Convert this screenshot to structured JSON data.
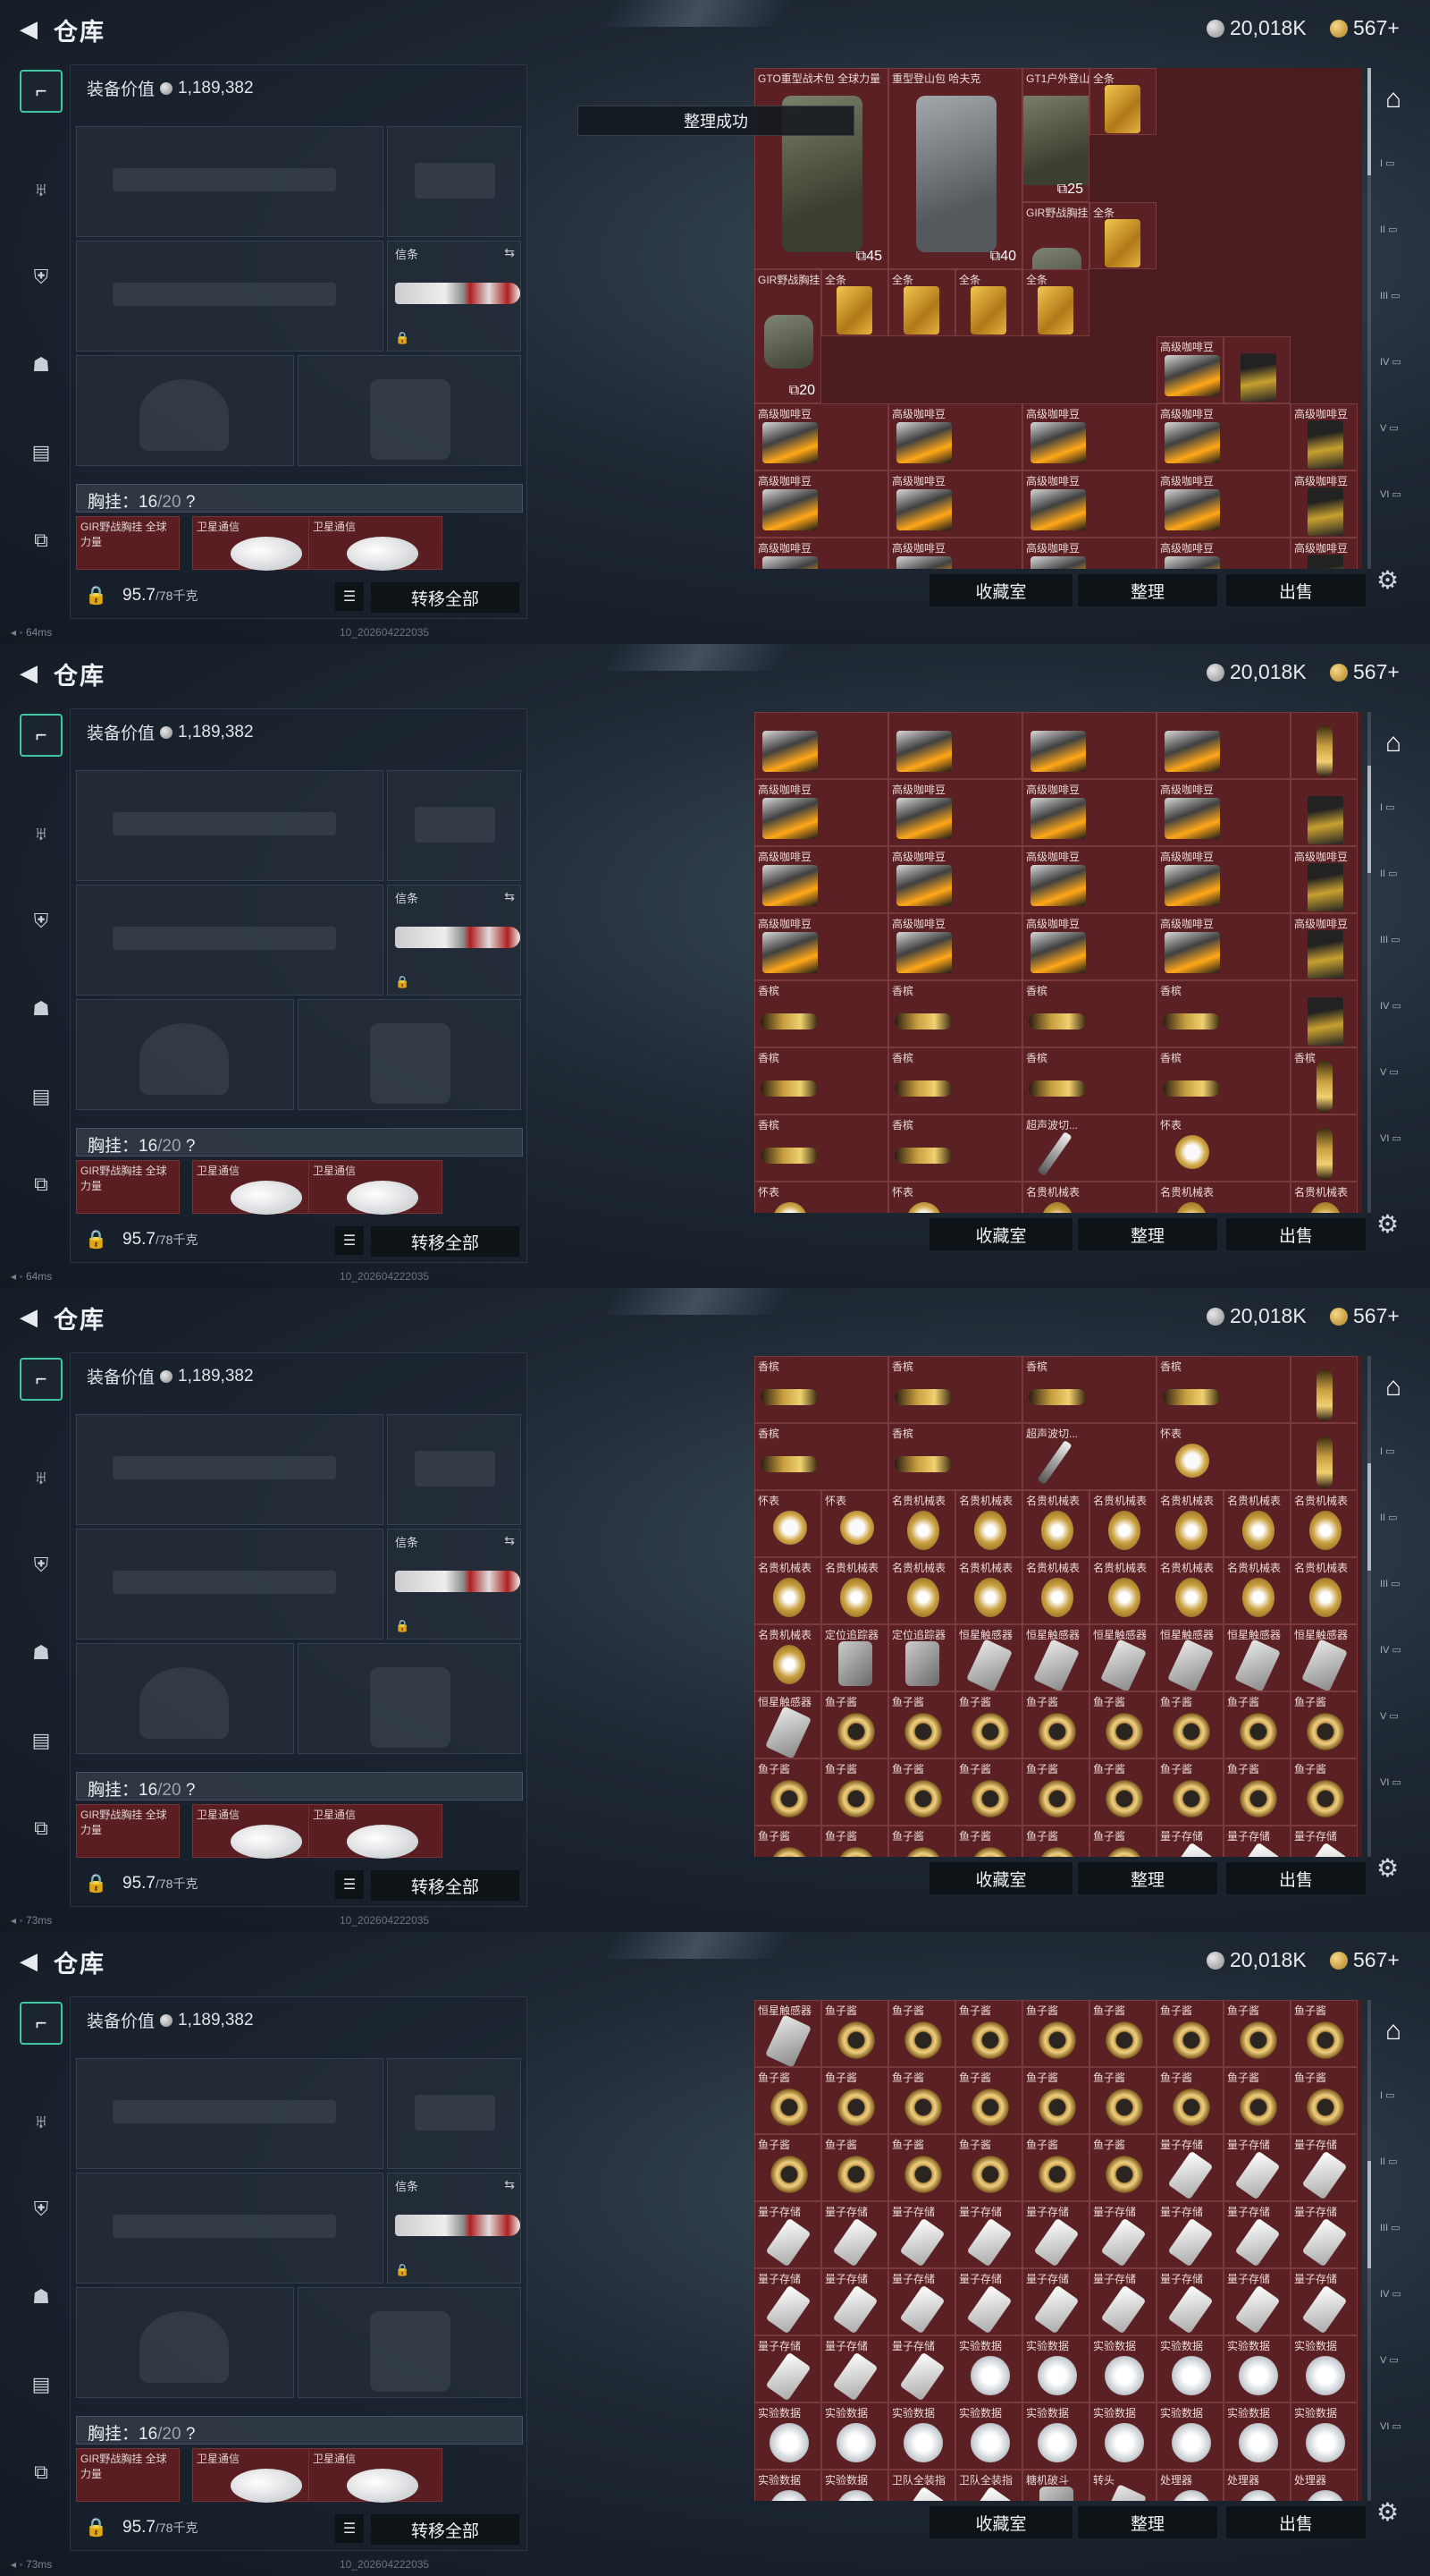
{
  "header": {
    "title": "仓库",
    "silver": "20,018K",
    "gold": "567+"
  },
  "loadout": {
    "equip_value_label": "装备价值",
    "equip_value": "1,189,382",
    "knife_label": "信条",
    "chest_label": "胸挂：",
    "chest_used": "16",
    "chest_cap": "/20",
    "chest_help": "?",
    "chest_slots": [
      "GIR野战胸挂 全球力量",
      "卫星通信",
      "卫星通信"
    ],
    "weight": "95.7",
    "weight_cap": "/78千克",
    "transfer_all": "转移全部"
  },
  "toast": "整理成功",
  "actions": {
    "collection": "收藏室",
    "sort": "整理",
    "sell": "出售"
  },
  "status": [
    "64ms",
    "64ms",
    "73ms",
    "73ms"
  ],
  "build": "10_202604222035",
  "frames": [
    {
      "show_toast": true,
      "items": [
        {
          "label": "GTO重型战术包 全球力量",
          "type": "bag",
          "c": 0,
          "r": 0,
          "w": 2,
          "h": 3,
          "qty": "45"
        },
        {
          "label": "重型登山包 哈夫克",
          "type": "baggrey",
          "c": 2,
          "r": 0,
          "w": 2,
          "h": 3,
          "qty": "40"
        },
        {
          "label": "GT1户外登山包 全球力量",
          "type": "bag",
          "c": 4,
          "r": 0,
          "w": 1,
          "h": 2,
          "qty": "25"
        },
        {
          "label": "全条",
          "type": "gold",
          "c": 5,
          "r": 0
        },
        {
          "label": "GIR野战胸挂 全球力量",
          "type": "vest",
          "c": 4,
          "r": 2,
          "w": 1,
          "h": 2,
          "qty": "20"
        },
        {
          "label": "全条",
          "type": "gold",
          "c": 5,
          "r": 2
        },
        {
          "label": "GIR野战胸挂 全球力量",
          "type": "vest",
          "c": 0,
          "r": 3,
          "w": 1,
          "h": 2,
          "qty": "20"
        },
        {
          "label": "全条",
          "type": "gold",
          "c": 1,
          "r": 3
        },
        {
          "label": "全条",
          "type": "gold",
          "c": 2,
          "r": 3
        },
        {
          "label": "全条",
          "type": "gold",
          "c": 3,
          "r": 3
        },
        {
          "label": "全条",
          "type": "gold",
          "c": 4,
          "r": 3
        },
        {
          "label": "高级咖啡豆",
          "type": "coffee",
          "c": 6,
          "r": 4
        },
        {
          "label": "",
          "type": "beans",
          "c": 7,
          "r": 4
        }
      ],
      "rows": [
        {
          "r": 5,
          "cells": [
            "高级咖啡豆",
            "高级咖啡豆",
            "高级咖啡豆",
            "高级咖啡豆",
            "高级咖啡豆"
          ],
          "types": [
            "coffee",
            "coffee",
            "coffee",
            "coffee",
            "beans"
          ]
        },
        {
          "r": 6,
          "cells": [
            "高级咖啡豆",
            "高级咖啡豆",
            "高级咖啡豆",
            "高级咖啡豆",
            "高级咖啡豆"
          ],
          "types": [
            "coffee",
            "coffee",
            "coffee",
            "coffee",
            "beans"
          ]
        },
        {
          "r": 7,
          "cells": [
            "高级咖啡豆",
            "高级咖啡豆",
            "高级咖啡豆",
            "高级咖啡豆",
            "高级咖啡豆"
          ],
          "types": [
            "coffee",
            "coffee",
            "coffee",
            "coffee",
            "beans"
          ]
        }
      ],
      "scroll": 0
    },
    {
      "show_toast": false,
      "items": [],
      "rows": [
        {
          "r": 0,
          "cells": [
            "",
            "",
            "",
            "",
            ""
          ],
          "types": [
            "coffee",
            "coffee",
            "coffee",
            "coffee",
            "champv"
          ]
        },
        {
          "r": 1,
          "cells": [
            "高级咖啡豆",
            "高级咖啡豆",
            "高级咖啡豆",
            "高级咖啡豆",
            ""
          ],
          "types": [
            "coffee",
            "coffee",
            "coffee",
            "coffee",
            "beans"
          ]
        },
        {
          "r": 2,
          "cells": [
            "高级咖啡豆",
            "高级咖啡豆",
            "高级咖啡豆",
            "高级咖啡豆",
            "高级咖啡豆"
          ],
          "types": [
            "coffee",
            "coffee",
            "coffee",
            "coffee",
            "beans"
          ]
        },
        {
          "r": 3,
          "cells": [
            "高级咖啡豆",
            "高级咖啡豆",
            "高级咖啡豆",
            "高级咖啡豆",
            "高级咖啡豆"
          ],
          "types": [
            "coffee",
            "coffee",
            "coffee",
            "coffee",
            "beans"
          ]
        },
        {
          "r": 4,
          "cells": [
            "香槟",
            "香槟",
            "香槟",
            "香槟",
            ""
          ],
          "types": [
            "champ",
            "champ",
            "champ",
            "champ",
            "beans"
          ]
        },
        {
          "r": 5,
          "cells": [
            "香槟",
            "香槟",
            "香槟",
            "香槟",
            "香槟"
          ],
          "types": [
            "champ",
            "champ",
            "champ",
            "champ",
            "champv"
          ]
        },
        {
          "r": 6,
          "cells": [
            "香槟",
            "香槟",
            "超声波切...",
            "怀表",
            ""
          ],
          "types": [
            "champ",
            "champ",
            "pen2",
            "pocket2",
            "champv"
          ]
        },
        {
          "r": 7,
          "cells": [
            "怀表",
            "怀表",
            "名贵机械表",
            "名贵机械表",
            "名贵机械表"
          ],
          "types": [
            "pocket",
            "pocket",
            "watch",
            "watch",
            "watch"
          ]
        }
      ],
      "scroll": 1
    },
    {
      "show_toast": false,
      "items": [],
      "rows": [
        {
          "r": 0,
          "cells": [
            "香槟",
            "香槟",
            "香槟",
            "香槟",
            ""
          ],
          "types": [
            "champ",
            "champ",
            "champ",
            "champ",
            "champv"
          ]
        },
        {
          "r": 1,
          "cells": [
            "香槟",
            "香槟",
            "超声波切...",
            "怀表",
            ""
          ],
          "types": [
            "champ",
            "champ",
            "pen2",
            "pocket2",
            "champv"
          ]
        },
        {
          "r": 2,
          "cells": [
            "怀表",
            "怀表",
            "名贵机械表",
            "名贵机械表",
            "名贵机械表",
            "名贵机械表",
            "名贵机械表",
            "名贵机械表",
            "名贵机械表"
          ],
          "types": [
            "pocket",
            "pocket",
            "watch",
            "watch",
            "watch",
            "watch",
            "watch",
            "watch",
            "watch"
          ],
          "full": true
        },
        {
          "r": 3,
          "cells": [
            "名贵机械表",
            "名贵机械表",
            "名贵机械表",
            "名贵机械表",
            "名贵机械表",
            "名贵机械表",
            "名贵机械表",
            "名贵机械表",
            "名贵机械表"
          ],
          "types": [
            "watch",
            "watch",
            "watch",
            "watch",
            "watch",
            "watch",
            "watch",
            "watch",
            "watch"
          ],
          "full": true
        },
        {
          "r": 4,
          "cells": [
            "名贵机械表",
            "定位追踪器",
            "定位追踪器",
            "恒星触感器",
            "恒星触感器",
            "恒星触感器",
            "恒星触感器",
            "恒星触感器",
            "恒星触感器"
          ],
          "types": [
            "watch",
            "locator",
            "locator",
            "sensor",
            "sensor",
            "sensor",
            "sensor",
            "sensor",
            "sensor"
          ],
          "full": true
        },
        {
          "r": 5,
          "cells": [
            "恒星触感器",
            "鱼子酱",
            "鱼子酱",
            "鱼子酱",
            "鱼子酱",
            "鱼子酱",
            "鱼子酱",
            "鱼子酱",
            "鱼子酱"
          ],
          "types": [
            "sensor",
            "ring",
            "ring",
            "ring",
            "ring",
            "ring",
            "ring",
            "ring",
            "ring"
          ],
          "full": true
        },
        {
          "r": 6,
          "cells": [
            "鱼子酱",
            "鱼子酱",
            "鱼子酱",
            "鱼子酱",
            "鱼子酱",
            "鱼子酱",
            "鱼子酱",
            "鱼子酱",
            "鱼子酱"
          ],
          "types": [
            "ring",
            "ring",
            "ring",
            "ring",
            "ring",
            "ring",
            "ring",
            "ring",
            "ring"
          ],
          "full": true
        },
        {
          "r": 7,
          "cells": [
            "鱼子酱",
            "鱼子酱",
            "鱼子酱",
            "鱼子酱",
            "鱼子酱",
            "鱼子酱",
            "量子存储",
            "量子存储",
            "量子存储"
          ],
          "types": [
            "ring",
            "ring",
            "ring",
            "ring",
            "ring",
            "ring",
            "usb",
            "usb",
            "usb"
          ],
          "full": true
        }
      ],
      "scroll": 2
    },
    {
      "show_toast": false,
      "items": [],
      "rows": [
        {
          "r": 0,
          "cells": [
            "恒星触感器",
            "鱼子酱",
            "鱼子酱",
            "鱼子酱",
            "鱼子酱",
            "鱼子酱",
            "鱼子酱",
            "鱼子酱",
            "鱼子酱"
          ],
          "types": [
            "sensor",
            "ring",
            "ring",
            "ring",
            "ring",
            "ring",
            "ring",
            "ring",
            "ring"
          ],
          "full": true
        },
        {
          "r": 1,
          "cells": [
            "鱼子酱",
            "鱼子酱",
            "鱼子酱",
            "鱼子酱",
            "鱼子酱",
            "鱼子酱",
            "鱼子酱",
            "鱼子酱",
            "鱼子酱"
          ],
          "types": [
            "ring",
            "ring",
            "ring",
            "ring",
            "ring",
            "ring",
            "ring",
            "ring",
            "ring"
          ],
          "full": true
        },
        {
          "r": 2,
          "cells": [
            "鱼子酱",
            "鱼子酱",
            "鱼子酱",
            "鱼子酱",
            "鱼子酱",
            "鱼子酱",
            "量子存储",
            "量子存储",
            "量子存储"
          ],
          "types": [
            "ring",
            "ring",
            "ring",
            "ring",
            "ring",
            "ring",
            "usb",
            "usb",
            "usb"
          ],
          "full": true
        },
        {
          "r": 3,
          "cells": [
            "量子存储",
            "量子存储",
            "量子存储",
            "量子存储",
            "量子存储",
            "量子存储",
            "量子存储",
            "量子存储",
            "量子存储"
          ],
          "types": [
            "usb",
            "usb",
            "usb",
            "usb",
            "usb",
            "usb",
            "usb",
            "usb",
            "usb"
          ],
          "full": true
        },
        {
          "r": 4,
          "cells": [
            "量子存储",
            "量子存储",
            "量子存储",
            "量子存储",
            "量子存储",
            "量子存储",
            "量子存储",
            "量子存储",
            "量子存储"
          ],
          "types": [
            "usb",
            "usb",
            "usb",
            "usb",
            "usb",
            "usb",
            "usb",
            "usb",
            "usb"
          ],
          "full": true
        },
        {
          "r": 5,
          "cells": [
            "量子存储",
            "量子存储",
            "量子存储",
            "实验数据",
            "实验数据",
            "实验数据",
            "实验数据",
            "实验数据",
            "实验数据"
          ],
          "types": [
            "usb",
            "usb",
            "usb",
            "disc",
            "disc",
            "disc",
            "disc",
            "disc",
            "disc"
          ],
          "full": true
        },
        {
          "r": 6,
          "cells": [
            "实验数据",
            "实验数据",
            "实验数据",
            "实验数据",
            "实验数据",
            "实验数据",
            "实验数据",
            "实验数据",
            "实验数据"
          ],
          "types": [
            "disc",
            "disc",
            "disc",
            "disc",
            "disc",
            "disc",
            "disc",
            "disc",
            "disc"
          ],
          "full": true
        },
        {
          "r": 7,
          "cells": [
            "实验数据",
            "实验数据",
            "卫队全装指",
            "卫队全装指",
            "糖机破斗",
            "转头",
            "处理器",
            "处理器",
            "处理器"
          ],
          "types": [
            "disc",
            "disc",
            "usb",
            "usb",
            "locator",
            "sensor",
            "disc",
            "disc",
            "disc"
          ],
          "full": true
        }
      ],
      "scroll": 3
    }
  ]
}
